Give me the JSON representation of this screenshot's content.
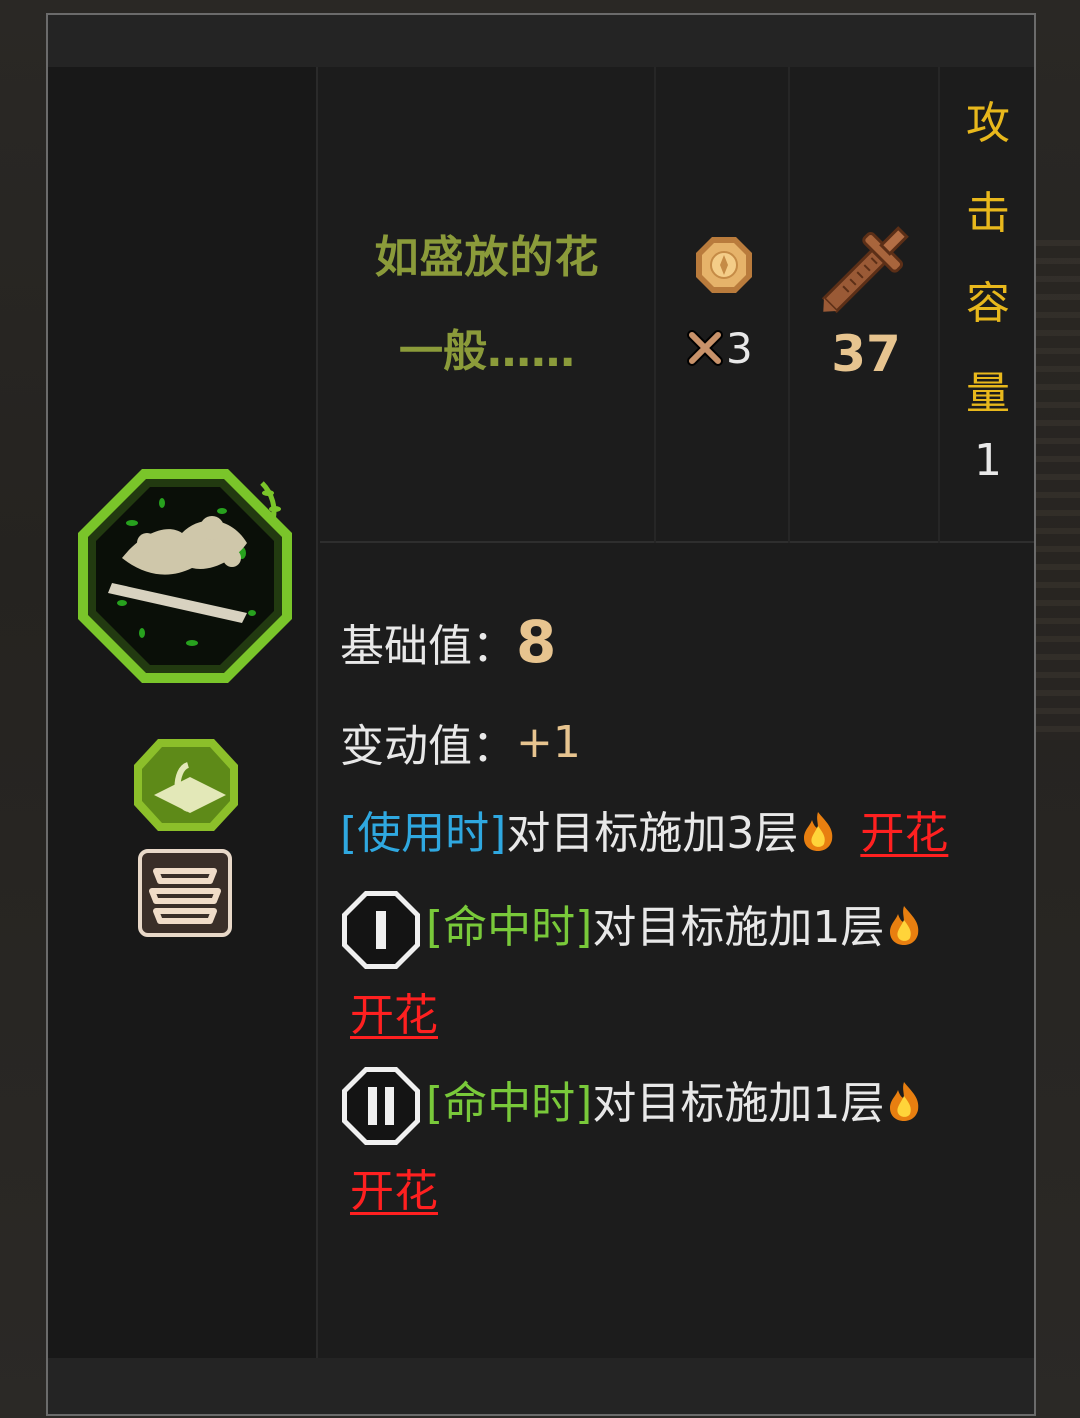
{
  "card": {
    "name": "如盛放的花",
    "rarity": "一般……",
    "cost": "3",
    "power": "37",
    "capacity_label": "攻击容量",
    "capacity_value": "1"
  },
  "icons": {
    "art": "flower-weapon-art",
    "range": "melee-range-icon",
    "type": "stack-type-icon",
    "coin": "light-coin-icon",
    "cost_cross": "cross-icon",
    "sword": "sword-icon",
    "fire": "fire-icon"
  },
  "stats": {
    "base_label": "基础值：",
    "base_value": "8",
    "variable_label": "变动值：",
    "variable_value": "+1"
  },
  "effects": [
    {
      "tag": "[使用时]",
      "text": "对目标施加3层",
      "keyword": "开花"
    },
    {
      "dice": "I",
      "tag": "[命中时]",
      "text": "对目标施加1层",
      "keyword": "开花"
    },
    {
      "dice": "II",
      "tag": "[命中时]",
      "text": "对目标施加1层",
      "keyword": "开花"
    }
  ],
  "colors": {
    "name": "#8b9b3a",
    "power": "#e7c48f",
    "capacity_label": "#e8b81c",
    "tag_use": "#2fa8e0",
    "tag_hit": "#79c93a",
    "keyword": "#ff2020",
    "frame_green": "#7ac52a"
  }
}
